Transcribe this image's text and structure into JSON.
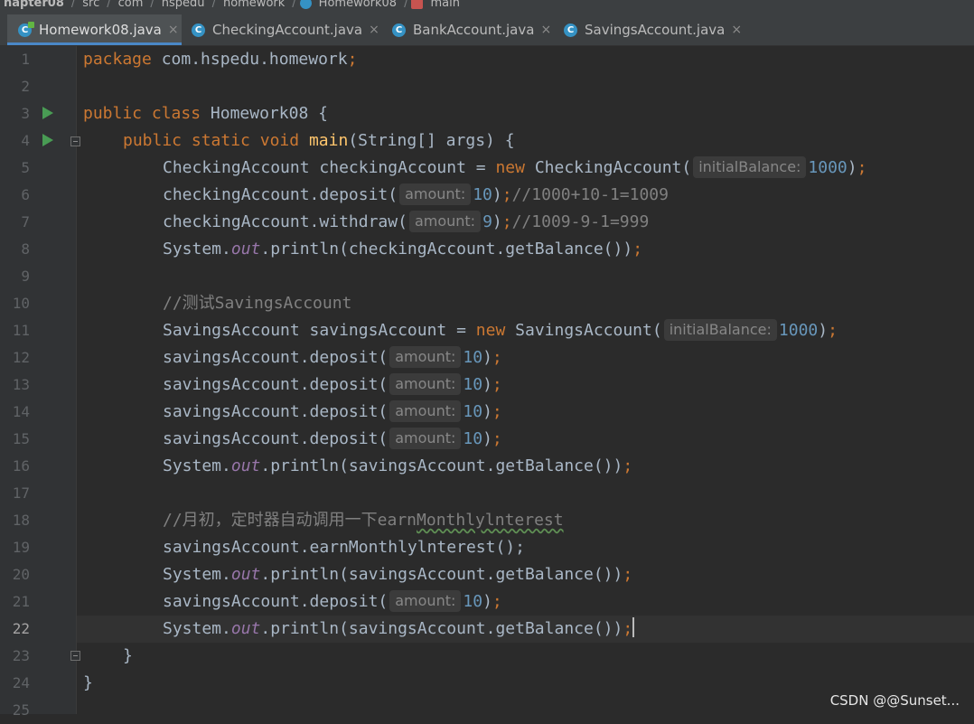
{
  "breadcrumb": [
    "hapter08",
    "src",
    "com",
    "hspedu",
    "homework",
    "Homework08",
    "main"
  ],
  "tabs": [
    {
      "label": "Homework08.java",
      "close": "×"
    },
    {
      "label": "CheckingAccount.java",
      "close": "×"
    },
    {
      "label": "BankAccount.java",
      "close": "×"
    },
    {
      "label": "SavingsAccount.java",
      "close": "×"
    }
  ],
  "tab_icon_letter": "C",
  "line_numbers": [
    "1",
    "2",
    "3",
    "4",
    "5",
    "6",
    "7",
    "8",
    "9",
    "10",
    "11",
    "12",
    "13",
    "14",
    "15",
    "16",
    "17",
    "18",
    "19",
    "20",
    "21",
    "22",
    "23",
    "24",
    "25"
  ],
  "current_line": "22",
  "code": {
    "kw_package": "package",
    "pkg_name": " com.hspedu.homework",
    "semicolon": ";",
    "kw_public": "public",
    "kw_class": "class",
    "class_name": "Homework08",
    "open_brace": "{",
    "kw_static": "static",
    "kw_void": "void",
    "main_name": "main",
    "main_params": "(String[] args) {",
    "checking_decl": "CheckingAccount checkingAccount = ",
    "kw_new": "new",
    "checking_ctor": "CheckingAccount(",
    "hint_initialBalance": "initialBalance:",
    "num_1000": "1000",
    "close_paren": ")",
    "checking_deposit": "checkingAccount.deposit(",
    "hint_amount": "amount:",
    "num_10": "10",
    "comment_6": "//1000+10-1=1009",
    "checking_withdraw": "checkingAccount.withdraw(",
    "num_9": "9",
    "comment_7": "//1009-9-1=999",
    "system_prefix": "System.",
    "out": "out",
    "println_checking": ".println(checkingAccount.getBalance())",
    "comment_10": "//测试SavingsAccount",
    "savings_decl": "SavingsAccount savingsAccount = ",
    "savings_ctor": "SavingsAccount(",
    "savings_deposit": "savingsAccount.deposit(",
    "println_savings": ".println(savingsAccount.getBalance())",
    "comment_18_a": "//月初，定时器自动调用一下earn",
    "comment_18_b": "Monthlylnterest",
    "earn_call": "savingsAccount.earnMonthlylnterest();",
    "close_brace": "}"
  },
  "watermark": "CSDN @@Sunset...",
  "colors": {
    "background": "#2b2b2b",
    "keyword": "#cc7832",
    "method_decl": "#ffc66d",
    "number": "#6897bb",
    "comment": "#808080",
    "static_field": "#9876aa",
    "text": "#a9b7c6",
    "active_tab_underline": "#4a88c7",
    "run_icon": "#499c54"
  },
  "icons": {
    "class_icon": "class-c-icon",
    "run_icon": "run-gutter-icon",
    "fold_icon": "fold-marker-icon",
    "close_icon": "close-tab-icon"
  }
}
